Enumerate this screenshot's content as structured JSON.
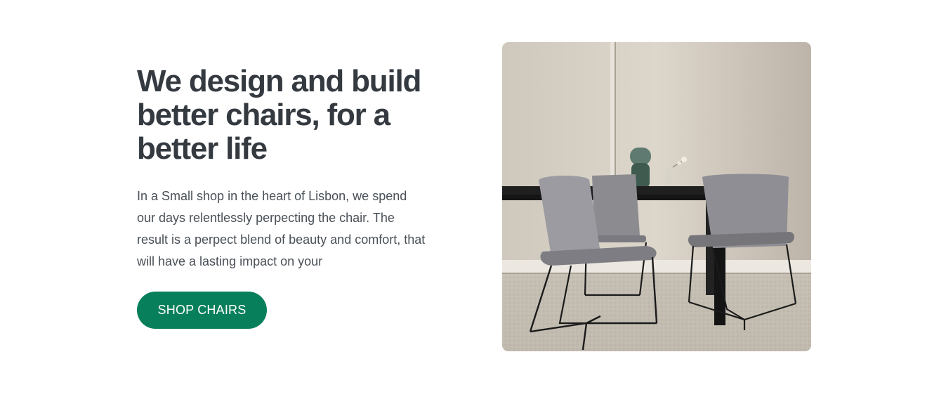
{
  "hero": {
    "title": "We design and build better chairs, for a better life",
    "description": "In a Small shop in the heart of Lisbon, we spend our days relentlessly perpecting the chair. The result is a perpect blend of beauty and comfort, that will have a lasting impact on your",
    "cta_label": "SHOP CHAIRS"
  },
  "colors": {
    "accent": "#087f5b",
    "heading": "#343a40",
    "body_text": "#495057",
    "background": "#ffffff"
  },
  "image": {
    "subject": "dining-table-with-grey-chairs"
  }
}
